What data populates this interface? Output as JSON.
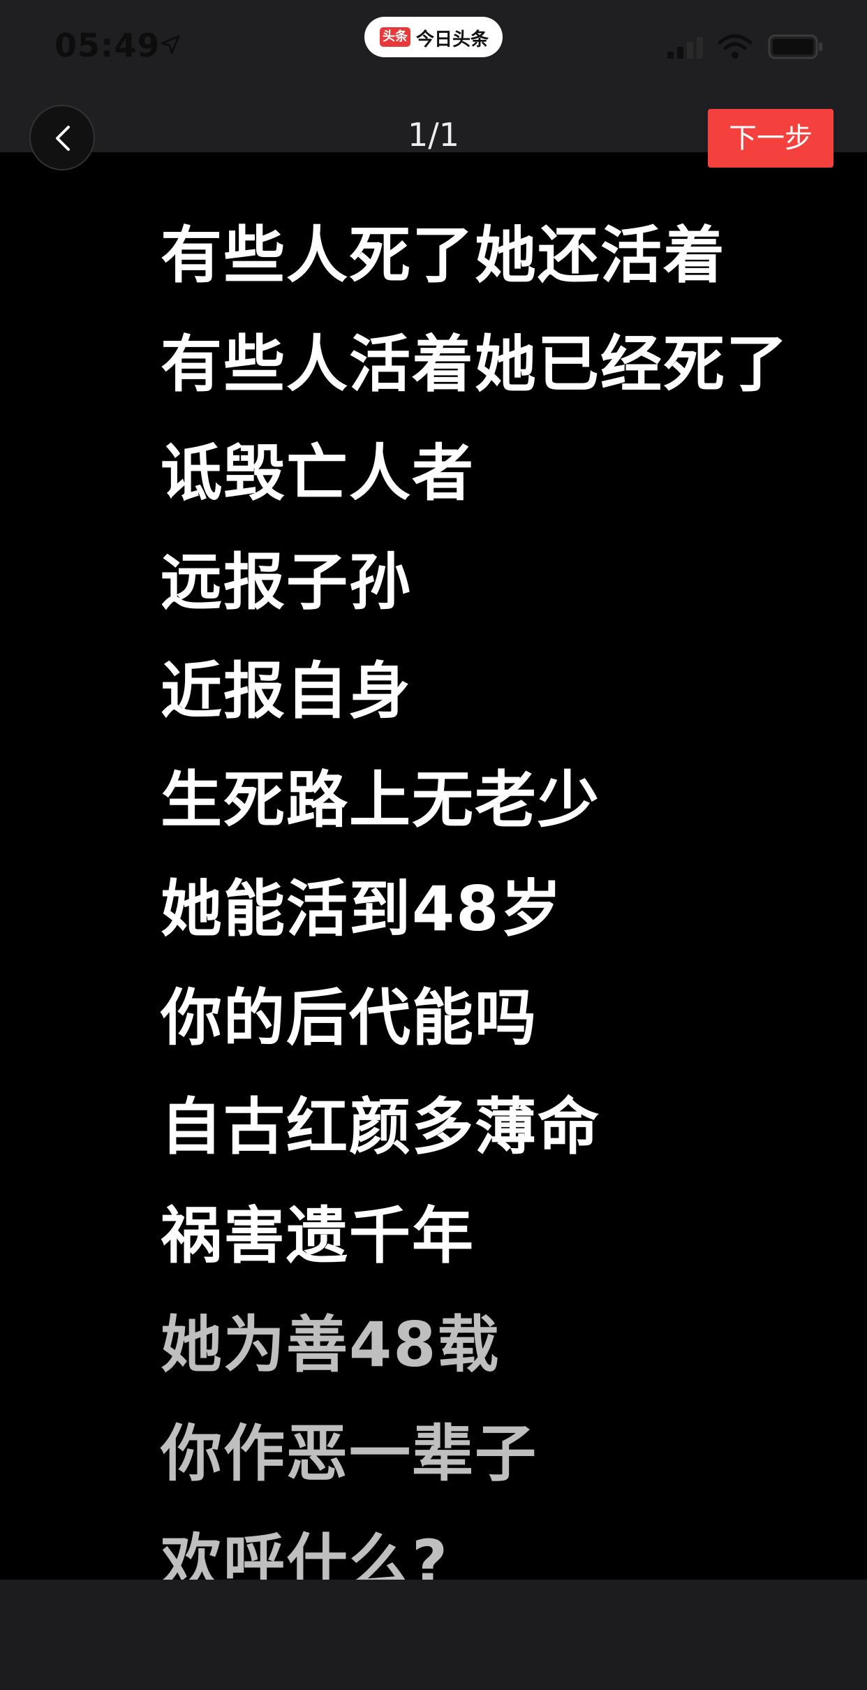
{
  "status_bar": {
    "time": "05:49",
    "app_badge": "头条",
    "app_name": "今日头条"
  },
  "nav": {
    "page_indicator": "1/1",
    "next_label": "下一步"
  },
  "content": {
    "lines": [
      "有些人死了她还活着",
      "有些人活着她已经死了",
      "诋毁亡人者",
      "远报子孙",
      "近报自身",
      "生死路上无老少",
      "她能活到48岁",
      "你的后代能吗",
      "自古红颜多薄命",
      "祸害遗千年",
      "她为善48载",
      "你作恶一辈子",
      "欢呼什么?"
    ]
  },
  "colors": {
    "accent": "#f4413e",
    "top_bar": "#1f1f21",
    "bottom_bar": "#1c1c1e",
    "background": "#000000"
  },
  "icons": [
    "location-arrow-icon",
    "signal-icon",
    "wifi-icon",
    "battery-icon",
    "chevron-left-icon"
  ]
}
